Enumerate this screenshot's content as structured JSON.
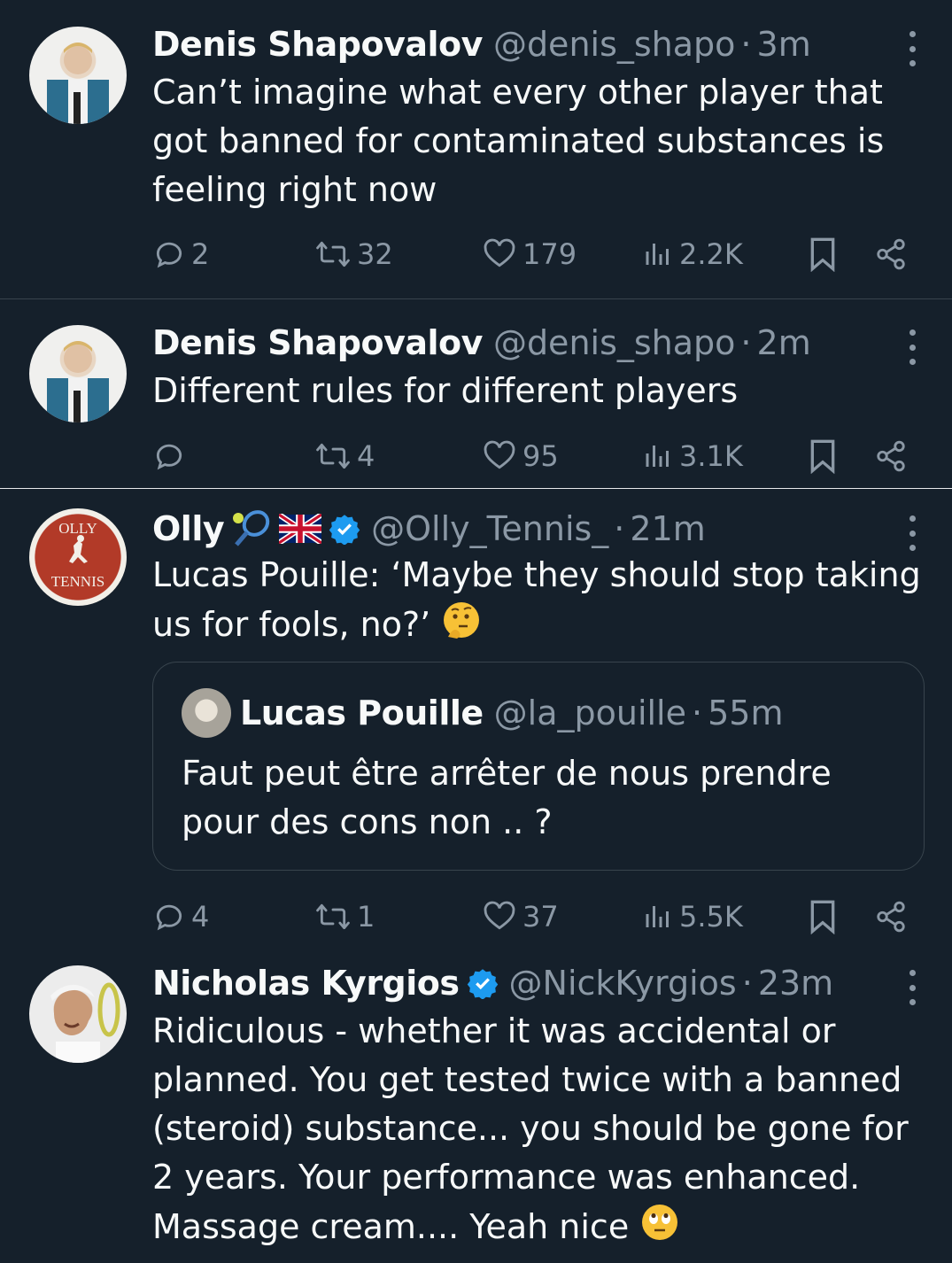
{
  "tweets": [
    {
      "name": "Denis Shapovalov",
      "handle": "@denis_shapo",
      "time": "3m",
      "text": "Can’t imagine what every other player that got banned for contaminated substances is feeling right now",
      "replies": "2",
      "retweets": "32",
      "likes": "179",
      "views": "2.2K"
    },
    {
      "name": "Denis Shapovalov",
      "handle": "@denis_shapo",
      "time": "2m",
      "text": "Different rules for different players",
      "replies": "",
      "retweets": "4",
      "likes": "95",
      "views": "3.1K"
    },
    {
      "name": "Olly",
      "handle": "@Olly_Tennis_",
      "time": "21m",
      "text": "Lucas Pouille: ‘Maybe they should stop taking us for fools, no?’",
      "replies": "4",
      "retweets": "1",
      "likes": "37",
      "views": "5.5K",
      "avatar_text": {
        "top": "OLLY",
        "bottom": "TENNIS"
      },
      "quote": {
        "name": "Lucas Pouille",
        "handle": "@la_pouille",
        "time": "55m",
        "text": "Faut peut être arrêter de nous prendre pour des cons non .. ?"
      }
    },
    {
      "name": "Nicholas Kyrgios",
      "handle": "@NickKyrgios",
      "time": "23m",
      "text": "Ridiculous - whether it was accidental or planned. You get tested twice with a banned (steroid) substance... you should be gone for 2 years. Your performance was enhanced. Massage cream.... Yeah nice"
    }
  ],
  "separator": "·",
  "colors": {
    "background": "#15202b",
    "text": "#f7f9f9",
    "muted": "#8b98a5",
    "divider": "#38444d",
    "verified": "#1d9bf0"
  },
  "icons": [
    "reply-icon",
    "retweet-icon",
    "like-icon",
    "views-icon",
    "bookmark-icon",
    "share-icon",
    "more-icon",
    "verified-badge-icon",
    "tennis-racket-emoji",
    "uk-flag-emoji",
    "thinking-face-emoji",
    "eye-roll-emoji"
  ]
}
